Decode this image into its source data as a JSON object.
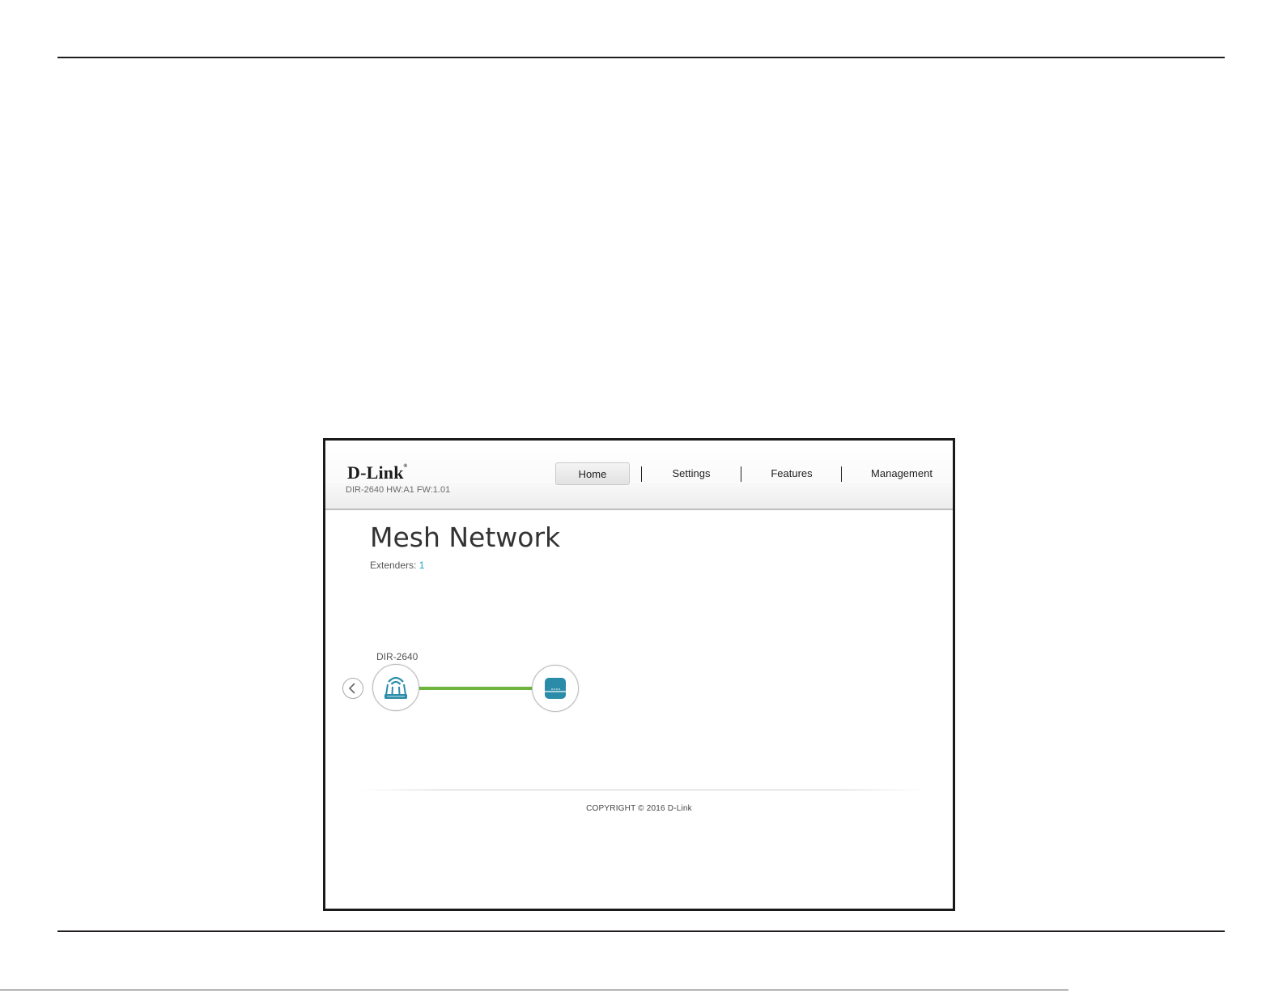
{
  "brand": {
    "logo": "D-Link",
    "model_info": "DIR-2640 HW:A1 FW:1.01"
  },
  "nav": {
    "items": [
      {
        "label": "Home",
        "active": true
      },
      {
        "label": "Settings",
        "active": false
      },
      {
        "label": "Features",
        "active": false
      },
      {
        "label": "Management",
        "active": false
      }
    ]
  },
  "main": {
    "title": "Mesh Network",
    "extenders_label": "Extenders:",
    "extenders_count": "1"
  },
  "topology": {
    "device_label": "DIR-2640",
    "icons": [
      "chevron-left-icon",
      "router-icon",
      "extender-icon"
    ],
    "link_color": "#6fb43f",
    "accent_color": "#2a8ca8"
  },
  "footer": {
    "copyright": "COPYRIGHT © 2016 D-Link"
  }
}
